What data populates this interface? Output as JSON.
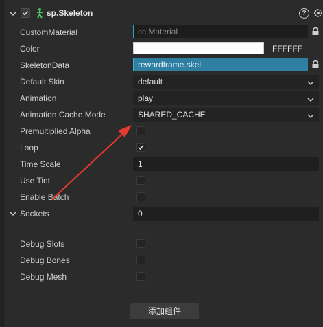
{
  "component": {
    "title": "sp.Skeleton",
    "enabled": true,
    "help_symbol": "?"
  },
  "properties": {
    "custom_material": {
      "label": "CustomMaterial",
      "value": "cc.Material"
    },
    "color": {
      "label": "Color",
      "hex": "FFFFFF",
      "swatch": "#ffffff"
    },
    "skeleton_data": {
      "label": "SkeletonData",
      "value": "rewardframe.skel"
    },
    "default_skin": {
      "label": "Default Skin",
      "value": "default"
    },
    "animation": {
      "label": "Animation",
      "value": "play"
    },
    "animation_cache_mode": {
      "label": "Animation Cache Mode",
      "value": "SHARED_CACHE"
    },
    "premultiplied_alpha": {
      "label": "Premultiplied Alpha",
      "checked": false
    },
    "loop": {
      "label": "Loop",
      "checked": true
    },
    "time_scale": {
      "label": "Time Scale",
      "value": "1"
    },
    "use_tint": {
      "label": "Use Tint",
      "checked": false
    },
    "enable_batch": {
      "label": "Enable Batch",
      "checked": false
    },
    "sockets": {
      "label": "Sockets",
      "value": "0"
    },
    "debug_slots": {
      "label": "Debug Slots",
      "checked": false
    },
    "debug_bones": {
      "label": "Debug Bones",
      "checked": false
    },
    "debug_mesh": {
      "label": "Debug Mesh",
      "checked": false
    }
  },
  "add_component_label": "添加组件",
  "colors": {
    "accent": "#2aa3c8",
    "asset_filled": "#2f7fa3",
    "annotation_arrow": "#e53a2f"
  }
}
